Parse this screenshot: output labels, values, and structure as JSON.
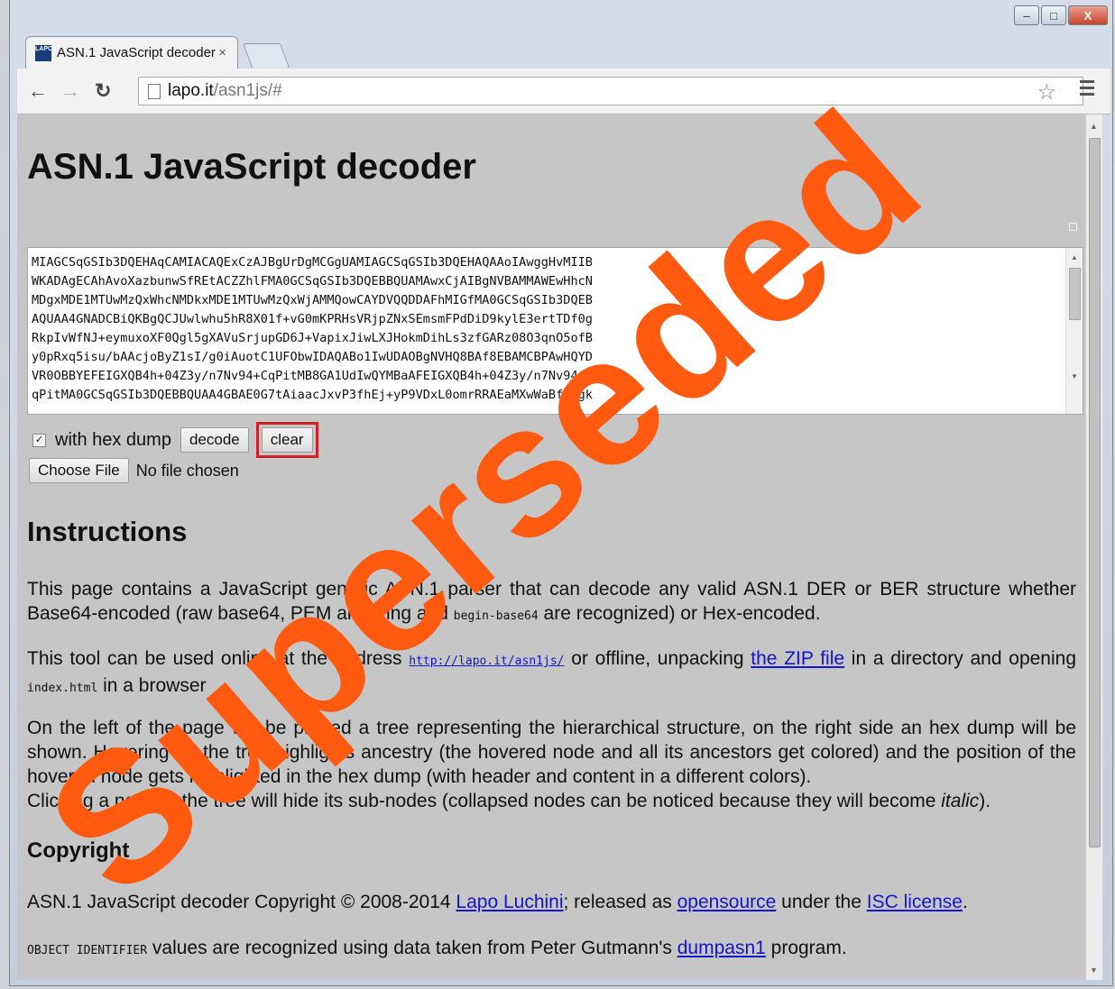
{
  "browser": {
    "tab_title": "ASN.1 JavaScript decoder",
    "tab_close": "×",
    "url_host": "lapo.it",
    "url_path": "/asn1js/#",
    "favicon_text": "LAPO"
  },
  "window_controls": {
    "minimize": "–",
    "maximize": "□",
    "close": "X"
  },
  "page": {
    "title": "ASN.1 JavaScript decoder",
    "input_text": "MIAGCSqGSIb3DQEHAqCAMIACAQExCzAJBgUrDgMCGgUAMIAGCSqGSIb3DQEHAQAAoIAwggHvMIIB\nWKADAgECAhAvoXazbunwSfREtACZZhlFMA0GCSqGSIb3DQEBBQUAMAwxCjAIBgNVBAMMAWEwHhcN\nMDgxMDE1MTUwMzQxWhcNMDkxMDE1MTUwMzQxWjAMMQowCAYDVQQDDAFhMIGfMA0GCSqGSIb3DQEB\nAQUAA4GNADCBiQKBgQCJUwlwhu5hR8X01f+vG0mKPRHsVRjpZNxSEmsmFPdDiD9kylE3ertTDf0g\nRkpIvWfNJ+eymuxoXF0Qgl5gXAVuSrjupGD6J+VapixJiwLXJHokmDihLs3zfGARz08O3qnO5ofB\ny0pRxq5isu/bAAcjoByZ1sI/g0iAuotC1UFObwIDAQABo1IwUDAOBgNVHQ8BAf8EBAMCBPAwHQYD\nVR0OBBYEFEIGXQB4h+04Z3y/n7Nv94+CqPitMB8GA1UdIwQYMBaAFEIGXQB4h+04Z3y/n7Nv94+C\nqPitMA0GCSqGSIb3DQEBBQUAA4GBAE0G7tAiaacJxvP3fhEj+yP9VDxL0omrRRAEaMXwWaBf/Ggk",
    "hex_dump_label": "with hex dump",
    "decode_label": "decode",
    "clear_label": "clear",
    "choose_file_label": "Choose File",
    "no_file_label": "No file chosen"
  },
  "instructions": {
    "heading": "Instructions",
    "p1_a": "This page contains a JavaScript generic ASN.1 parser that can decode any valid ASN.1 DER or BER structure whether Base64-encoded (raw base64, PEM armoring and ",
    "p1_code": "begin-base64",
    "p1_b": " are recognized) or Hex-encoded.",
    "p2_a": "This tool can be used online at the address ",
    "p2_link": "http://lapo.it/asn1js/",
    "p2_b": " or offline, unpacking ",
    "p2_link2": "the ZIP file",
    "p2_c": " in a directory and opening ",
    "p2_code": "index.html",
    "p2_d": " in a browser",
    "p3_a": "On the left of the page will be printed a tree representing the hierarchical structure, on the right side an hex dump will be shown. Hovering on the tree highlights ancestry (the hovered node and all its ancestors get colored) and the position of the hovered node gets highlighted in the hex dump (with header and content in a different colors).",
    "p3_b": "Clicking a node in the tree will hide its sub-nodes (collapsed nodes can be noticed because they will become ",
    "p3_italic": "italic",
    "p3_c": ")."
  },
  "copyright": {
    "heading": "Copyright",
    "line1_a": "ASN.1 JavaScript decoder Copyright © 2008-2014 ",
    "line1_author": "Lapo Luchini",
    "line1_b": "; released as ",
    "line1_opensource": "opensource",
    "line1_c": " under the ",
    "line1_license": "ISC license",
    "line1_d": ".",
    "line2_code": "OBJECT IDENTIFIER",
    "line2_a": " values are recognized using data taken from Peter Gutmann's ",
    "line2_link": "dumpasn1",
    "line2_b": " program."
  },
  "watermark": {
    "text": "Superseded",
    "color": "#ff5a10"
  },
  "colors": {
    "highlight_box": "#d0202a",
    "link": "#1515c8"
  }
}
